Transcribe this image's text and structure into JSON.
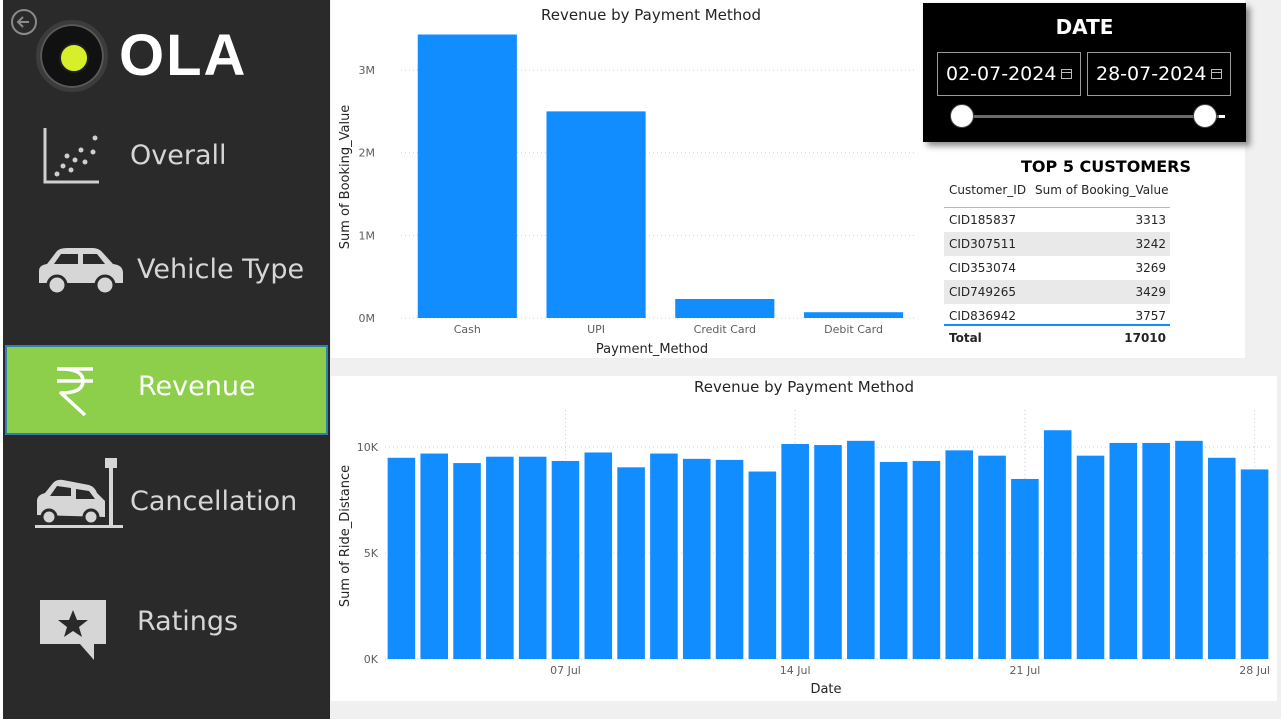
{
  "brand": {
    "name": "OLA"
  },
  "nav": {
    "items": [
      {
        "label": "Overall",
        "icon": "scatter-chart-icon"
      },
      {
        "label": "Vehicle Type",
        "icon": "car-icon"
      },
      {
        "label": "Revenue",
        "icon": "rupee-icon",
        "active": true
      },
      {
        "label": "Cancellation",
        "icon": "car-crash-icon"
      },
      {
        "label": "Ratings",
        "icon": "star-comment-icon"
      }
    ]
  },
  "colors": {
    "accent": "#118dff",
    "active_nav": "#8dcf4a",
    "sidebar": "#2a2a2a"
  },
  "date_slicer": {
    "title": "DATE",
    "start": "02-07-2024",
    "end": "28-07-2024"
  },
  "top_customers": {
    "title": "TOP 5 CUSTOMERS",
    "headers": [
      "Customer_ID",
      "Sum of Booking_Value"
    ],
    "rows": [
      {
        "id": "CID185837",
        "value": "3313"
      },
      {
        "id": "CID307511",
        "value": "3242"
      },
      {
        "id": "CID353074",
        "value": "3269"
      },
      {
        "id": "CID749265",
        "value": "3429"
      },
      {
        "id": "CID836942",
        "value": "3757"
      }
    ],
    "total_label": "Total",
    "total_value": "17010"
  },
  "chart_data": [
    {
      "type": "bar",
      "title": "Revenue by Payment Method",
      "xlabel": "Payment_Method",
      "ylabel": "Sum of Booking_Value",
      "categories": [
        "Cash",
        "UPI",
        "Credit Card",
        "Debit Card"
      ],
      "values": [
        3430000,
        2500000,
        230000,
        70000
      ],
      "ylim": [
        0,
        3400000
      ],
      "yticks": [
        {
          "value": 0,
          "label": "0M"
        },
        {
          "value": 1000000,
          "label": "1M"
        },
        {
          "value": 2000000,
          "label": "2M"
        },
        {
          "value": 3000000,
          "label": "3M"
        }
      ],
      "grid": true
    },
    {
      "type": "bar",
      "title": "Revenue by Payment Method",
      "xlabel": "Date",
      "ylabel": "Sum of Ride_Distance",
      "x": [
        "2024-07-02",
        "2024-07-03",
        "2024-07-04",
        "2024-07-05",
        "2024-07-06",
        "2024-07-07",
        "2024-07-08",
        "2024-07-09",
        "2024-07-10",
        "2024-07-11",
        "2024-07-12",
        "2024-07-13",
        "2024-07-14",
        "2024-07-15",
        "2024-07-16",
        "2024-07-17",
        "2024-07-18",
        "2024-07-19",
        "2024-07-20",
        "2024-07-21",
        "2024-07-22",
        "2024-07-23",
        "2024-07-24",
        "2024-07-25",
        "2024-07-26",
        "2024-07-27",
        "2024-07-28"
      ],
      "values": [
        9500,
        9700,
        9250,
        9550,
        9550,
        9350,
        9750,
        9050,
        9700,
        9450,
        9400,
        8850,
        10150,
        10100,
        10300,
        9300,
        9350,
        9850,
        9600,
        8500,
        10800,
        9600,
        10200,
        10200,
        10300,
        9500,
        8950
      ],
      "ylim": [
        0,
        11000
      ],
      "yticks": [
        {
          "value": 0,
          "label": "0K"
        },
        {
          "value": 5000,
          "label": "5K"
        },
        {
          "value": 10000,
          "label": "10K"
        }
      ],
      "xticks": [
        {
          "index": 5,
          "label": "07 Jul"
        },
        {
          "index": 12,
          "label": "14 Jul"
        },
        {
          "index": 19,
          "label": "21 Jul"
        },
        {
          "index": 26,
          "label": "28 Jul"
        }
      ],
      "grid": true
    }
  ]
}
